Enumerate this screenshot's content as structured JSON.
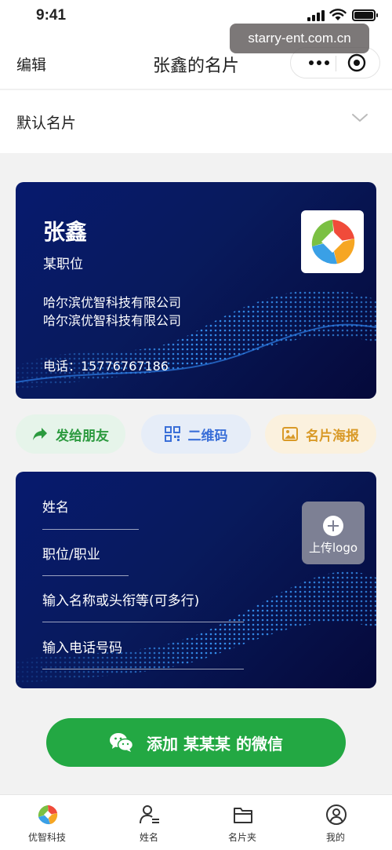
{
  "status_bar": {
    "time": "9:41"
  },
  "nav": {
    "edit": "编辑",
    "title": "张鑫的名片"
  },
  "watermark": "starry-ent.com.cn",
  "default_card": {
    "label": "默认名片"
  },
  "card": {
    "name": "张鑫",
    "position": "某职位",
    "company_line1": "哈尔滨优智科技有限公司",
    "company_line2": "哈尔滨优智科技有限公司",
    "phone": "电话：15776767186"
  },
  "actions": {
    "share": "发给朋友",
    "qrcode": "二维码",
    "poster": "名片海报"
  },
  "form": {
    "name_placeholder": "姓名",
    "position_placeholder": "职位/职业",
    "company_placeholder": "输入名称或头衔等(可多行)",
    "phone_placeholder": "输入电话号码",
    "upload_label": "上传logo"
  },
  "add_wechat": "添加 某某某 的微信",
  "tabbar": [
    {
      "label": "优智科技",
      "icon": "brand-logo-icon"
    },
    {
      "label": "姓名",
      "icon": "person-icon"
    },
    {
      "label": "名片夹",
      "icon": "folder-icon"
    },
    {
      "label": "我的",
      "icon": "user-circle-icon"
    }
  ],
  "colors": {
    "card_bg": "#081a5c",
    "primary_green": "#23a843",
    "share_green": "#2c9a3f",
    "qr_blue": "#3a6fd8",
    "poster_orange": "#d99a28"
  }
}
